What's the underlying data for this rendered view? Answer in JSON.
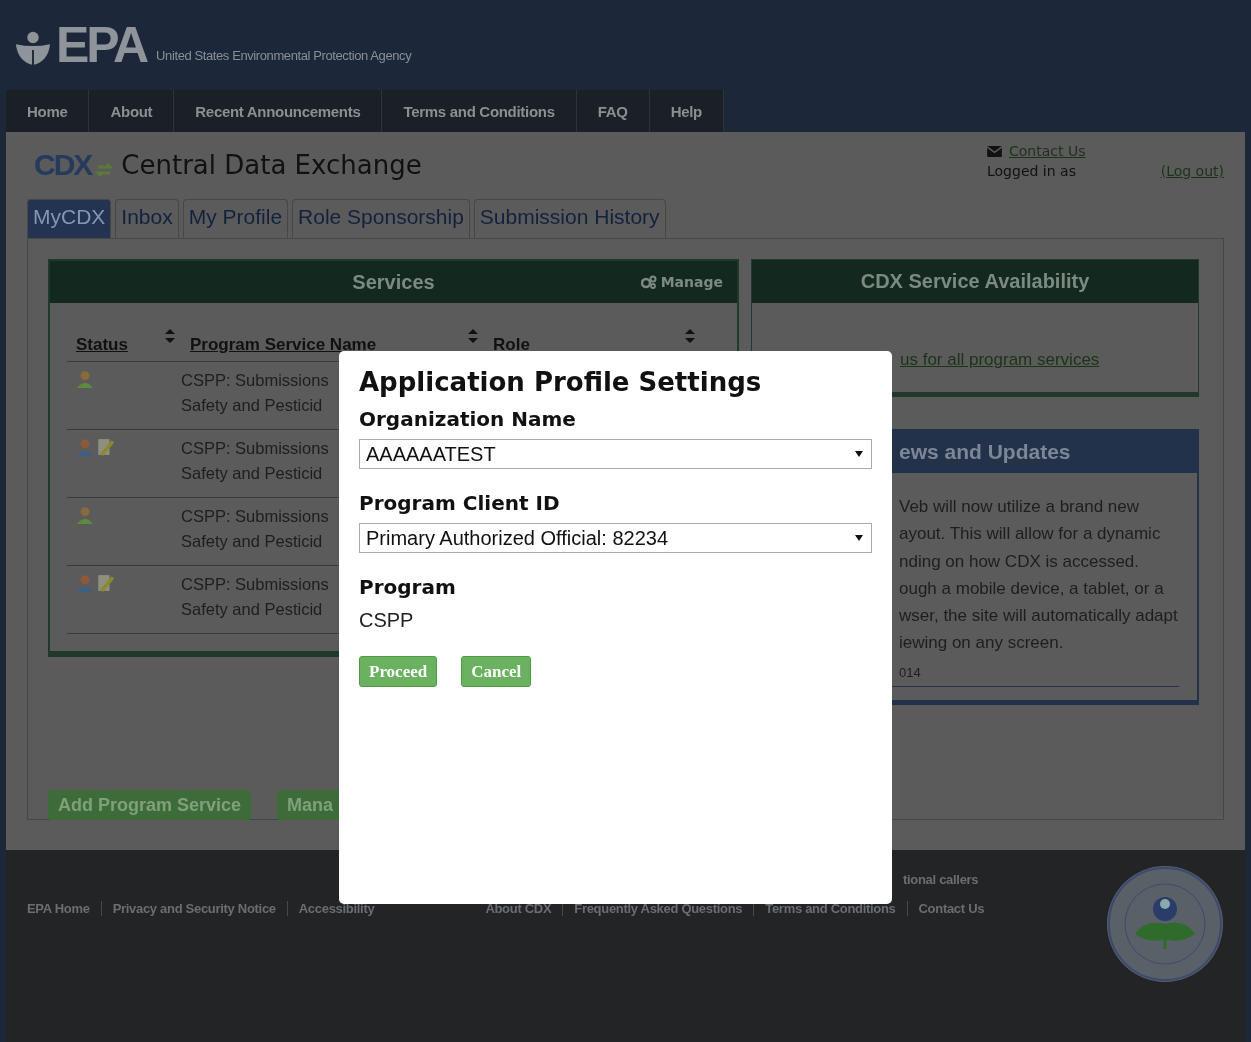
{
  "header": {
    "logo_text": "EPA",
    "agency": "United States Environmental Protection Agency"
  },
  "nav": [
    "Home",
    "About",
    "Recent Announcements",
    "Terms and Conditions",
    "FAQ",
    "Help"
  ],
  "app": {
    "logo_text": "CDX",
    "title": "Central Data Exchange",
    "contact": "Contact Us",
    "logged_in": "Logged in as",
    "logout": "(Log out)"
  },
  "tabs": [
    {
      "label": "MyCDX",
      "selected": true
    },
    {
      "label": "Inbox",
      "selected": false
    },
    {
      "label": "My Profile",
      "selected": false
    },
    {
      "label": "Role Sponsorship",
      "selected": false
    },
    {
      "label": "Submission History",
      "selected": false
    }
  ],
  "services": {
    "title": "Services",
    "manage": "Manage",
    "columns": [
      "Status",
      "Program Service Name",
      "Role"
    ],
    "rows": [
      {
        "kind": "user",
        "line_1": "CSPP: Submissions",
        "line_2": "Safety and Pesticid"
      },
      {
        "kind": "user-edit",
        "line_1": "CSPP: Submissions",
        "line_2": "Safety and Pesticid"
      },
      {
        "kind": "user",
        "line_1": "CSPP: Submissions",
        "line_2": "Safety and Pesticid"
      },
      {
        "kind": "user-edit",
        "line_1": "CSPP: Submissions",
        "line_2": "Safety and Pesticid"
      }
    ]
  },
  "buttons": [
    "Add Program Service",
    "Mana"
  ],
  "availability": {
    "title": "CDX Service Availability",
    "link": "us for all program services"
  },
  "news": {
    "title": "ews and Updates",
    "lines": [
      "Veb will now utilize a brand new",
      "ayout. This will allow for a dynamic",
      "nding on how CDX is accessed.",
      "ough a mobile device, a tablet, or a",
      "wser, the site will automatically adapt",
      "iewing on any screen."
    ],
    "date": "014"
  },
  "footer": {
    "callers": "tional callers",
    "left_links": [
      "EPA Home",
      "Privacy and Security Notice",
      "Accessibility"
    ],
    "right_links": [
      "About CDX",
      "Frequently Asked Questions",
      "Terms and Conditions",
      "Contact Us"
    ]
  },
  "modal": {
    "title": "Application Profile Settings",
    "fields": [
      {
        "kind": "select",
        "label": "Organization Name",
        "value": "AAAAAATEST"
      },
      {
        "kind": "select",
        "label": "Program Client ID",
        "value": "Primary Authorized Official: 82234"
      },
      {
        "kind": "text",
        "label": "Program",
        "value": "CSPP"
      }
    ],
    "buttons": [
      "Proceed",
      "Cancel"
    ]
  }
}
